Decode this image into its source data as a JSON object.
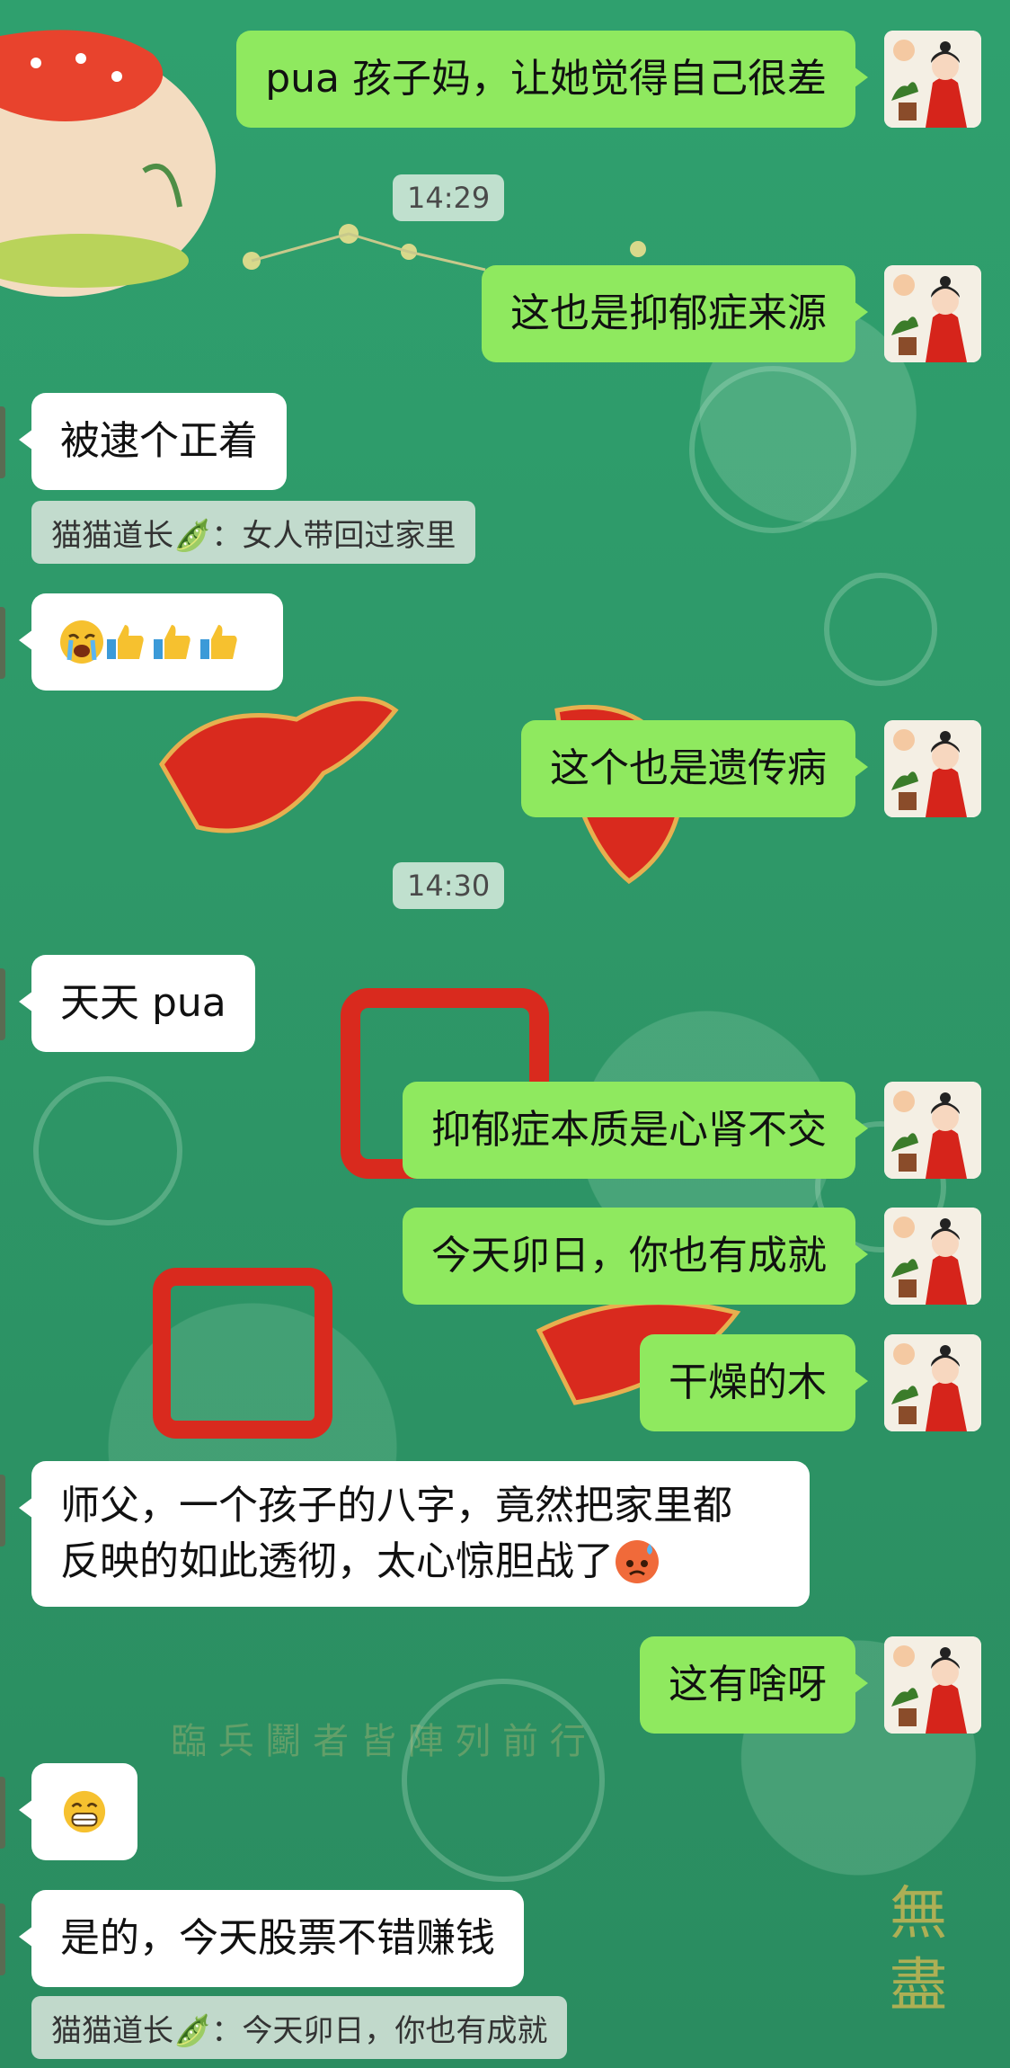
{
  "timestamps": [
    "14:29",
    "14:30"
  ],
  "messages": {
    "m1": "pua 孩子妈，让她觉得自己很差",
    "m2": "这也是抑郁症来源",
    "m3": "被逮个正着",
    "q1": "猫猫道长🫛：女人带回过家里",
    "m5": "这个也是遗传病",
    "m6": "天天 pua",
    "m7": "抑郁症本质是心肾不交",
    "m8": "今天卯日，你也有成就",
    "m9": "干燥的木",
    "m10_line1": "师父，一个孩子的八字，竟然把家里都",
    "m10_line2": "反映的如此透彻，太心惊胆战了",
    "m11": "这有啥呀",
    "m13": "是的，今天股票不错赚钱",
    "q2": "猫猫道长🫛：今天卯日，你也有成就"
  },
  "icons": {
    "avatar": "avatar-woman-red-dress",
    "crying": "crying-emoji",
    "thumb": "thumbs-up-emoji",
    "sweat": "anxious-sweat-emoji",
    "grin": "grinning-emoji"
  },
  "colors": {
    "outgoing_bubble": "#8fe95f",
    "incoming_bubble": "#ffffff",
    "background": "#2f9a6a"
  }
}
